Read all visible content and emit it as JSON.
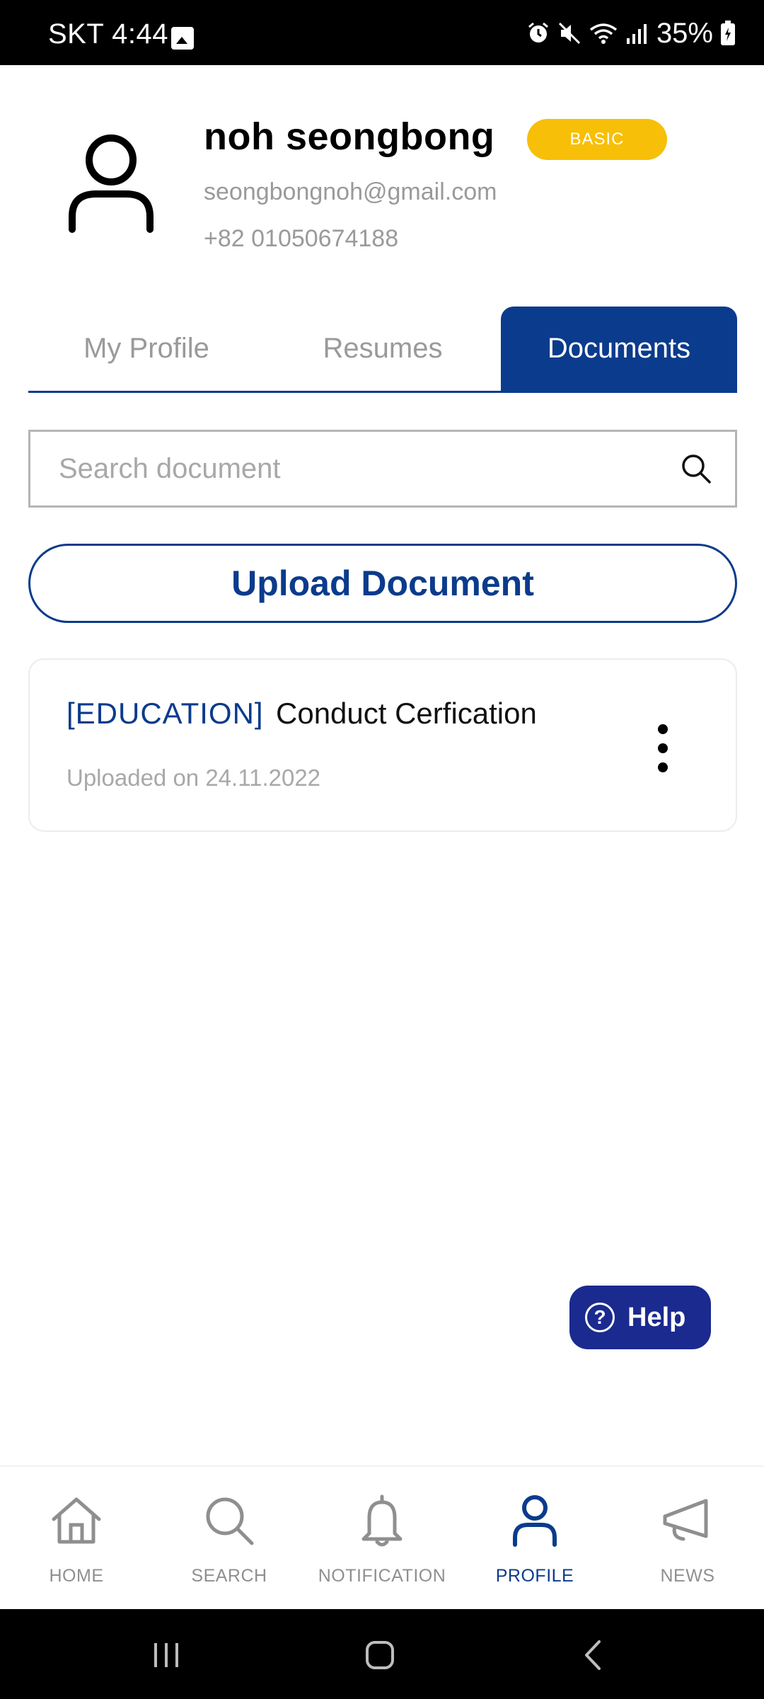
{
  "status_bar": {
    "carrier_time": "SKT 4:44",
    "battery": "35%"
  },
  "profile": {
    "name": "noh seongbong",
    "badge": "BASIC",
    "email": "seongbongnoh@gmail.com",
    "phone": "+82 01050674188"
  },
  "tabs": [
    {
      "label": "My Profile",
      "active": false
    },
    {
      "label": "Resumes",
      "active": false
    },
    {
      "label": "Documents",
      "active": true
    }
  ],
  "search": {
    "placeholder": "Search document",
    "value": ""
  },
  "upload_button": "Upload Document",
  "documents": [
    {
      "category": "[EDUCATION]",
      "title": "Conduct Cerfication",
      "date": "Uploaded on 24.11.2022"
    }
  ],
  "help_button": "Help",
  "bottom_nav": [
    {
      "label": "HOME",
      "icon": "home-icon",
      "active": false
    },
    {
      "label": "SEARCH",
      "icon": "search-icon",
      "active": false
    },
    {
      "label": "NOTIFICATION",
      "icon": "bell-icon",
      "active": false
    },
    {
      "label": "PROFILE",
      "icon": "person-icon",
      "active": true
    },
    {
      "label": "NEWS",
      "icon": "megaphone-icon",
      "active": false
    }
  ],
  "colors": {
    "primary": "#0b3b8c",
    "badge": "#f7bf07",
    "help": "#1b2a8f",
    "inactive": "#8f8f8f"
  }
}
